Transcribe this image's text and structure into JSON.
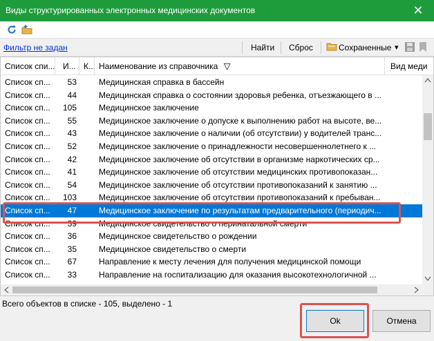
{
  "window": {
    "title": "Виды структурированных электронных медицинских документов",
    "close_glyph": "✕"
  },
  "toolbar": {
    "refresh_icon": "refresh-icon",
    "open_folder_icon": "folder-icon"
  },
  "filterbar": {
    "filter_link": "Фильтр не задан",
    "find_label": "Найти",
    "reset_label": "Сброс",
    "saved_label": "Сохраненные",
    "saved_arrow": "▾"
  },
  "grid": {
    "headers": [
      {
        "label": "Список спи..."
      },
      {
        "label": "И..."
      },
      {
        "label": "К..."
      },
      {
        "label": "Наименование из справочника"
      },
      {
        "label": "Вид меди"
      }
    ],
    "sort_glyph": "▽",
    "selected_index": 11,
    "rows": [
      {
        "list": "Список сп...",
        "id": "53",
        "k": "",
        "name": "Медицинская справка в бассейн"
      },
      {
        "list": "Список сп...",
        "id": "44",
        "k": "",
        "name": "Медицинская справка о состоянии здоровья ребенка, отъезжающего в ..."
      },
      {
        "list": "Список сп...",
        "id": "105",
        "k": "",
        "name": "Медицинское заключение"
      },
      {
        "list": "Список сп...",
        "id": "55",
        "k": "",
        "name": "Медицинское заключение о допуске к выполнению работ на высоте, ве..."
      },
      {
        "list": "Список сп...",
        "id": "43",
        "k": "",
        "name": "Медицинское заключение о наличии (об отсутствии) у водителей транс..."
      },
      {
        "list": "Список сп...",
        "id": "52",
        "k": "",
        "name": "Медицинское заключение о принадлежности несовершеннолетнего к ..."
      },
      {
        "list": "Список сп...",
        "id": "42",
        "k": "",
        "name": "Медицинское заключение об отсутствии в организме наркотических ср..."
      },
      {
        "list": "Список сп...",
        "id": "41",
        "k": "",
        "name": "Медицинское заключение об отсутствии медицинских противопоказан..."
      },
      {
        "list": "Список сп...",
        "id": "54",
        "k": "",
        "name": "Медицинское заключение об отсутствии противопоказаний к занятию ..."
      },
      {
        "list": "Список сп...",
        "id": "103",
        "k": "",
        "name": "Медицинское заключение об отсутствии противопоказаний к пребыван..."
      },
      {
        "list": "Список сп...",
        "id": "47",
        "k": "",
        "name": "Медицинское заключение по результатам предварительного (периодич..."
      },
      {
        "list": "Список сп...",
        "id": "39",
        "k": "",
        "name": "Медицинское свидетельство о перинатальной смерти"
      },
      {
        "list": "Список сп...",
        "id": "36",
        "k": "",
        "name": "Медицинское свидетельство о рождении"
      },
      {
        "list": "Список сп...",
        "id": "35",
        "k": "",
        "name": "Медицинское свидетельство о смерти"
      },
      {
        "list": "Список сп...",
        "id": "67",
        "k": "",
        "name": "Направление к месту лечения для получения медицинской помощи"
      },
      {
        "list": "Список сп...",
        "id": "33",
        "k": "",
        "name": "Направление на госпитализацию для оказания высокотехнологичной ..."
      }
    ]
  },
  "status": {
    "text": "Всего объектов в списке - 105, выделено - 1"
  },
  "buttons": {
    "ok": "Ok",
    "cancel": "Отмена"
  },
  "colors": {
    "titlebar": "#1e9c3c",
    "selection": "#0078d7",
    "highlight": "#d9534f"
  }
}
